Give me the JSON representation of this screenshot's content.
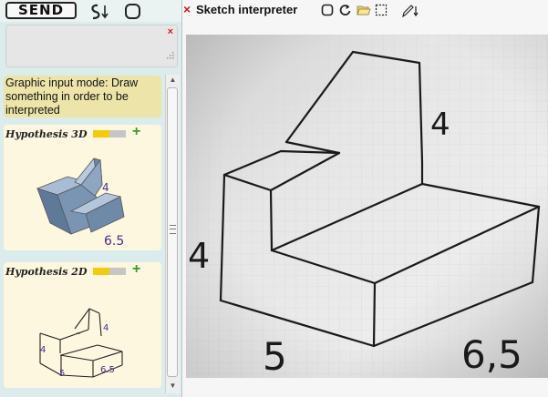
{
  "toolbar": {
    "send_label": "SEND",
    "icons": [
      "pen-arrow-icon",
      "rounded-square-icon"
    ]
  },
  "input_panel": {
    "close_symbol": "×"
  },
  "status": {
    "text": "Graphic input mode: Draw something in order to be interpreted"
  },
  "hypotheses": [
    {
      "title": "Hypothesis 3D",
      "confidence": 0.5,
      "add_symbol": "+",
      "labels": {
        "height": "4",
        "depth": "6.5"
      }
    },
    {
      "title": "Hypothesis 2D",
      "confidence": 0.5,
      "add_symbol": "+",
      "labels": {
        "top": "4",
        "left": "4",
        "front": "5",
        "right": "6.5"
      }
    }
  ],
  "sketch_panel": {
    "close_symbol": "×",
    "title": "Sketch interpreter",
    "icons": [
      "square-icon",
      "undo-icon",
      "open-folder-icon",
      "selection-icon",
      "pen-icon"
    ],
    "sketch_labels": {
      "top_height": "4",
      "left_height": "4",
      "front_width": "5",
      "right_depth": "6,5"
    }
  },
  "colors": {
    "status_bg": "#ece4a8",
    "card_bg": "#fcf7de",
    "confidence_fill": "#f2cb0a",
    "model_blue": "#7a95b3",
    "label_purple": "#4a2d8a"
  }
}
